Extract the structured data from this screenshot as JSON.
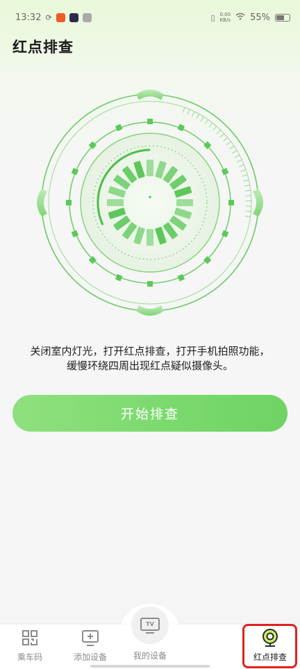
{
  "status_bar": {
    "time": "13:32",
    "net_speed_top": "0.00",
    "net_speed_bottom": "KB/s",
    "battery": "55%"
  },
  "page": {
    "title": "红点排查"
  },
  "instructions": {
    "line1": "关闭室内灯光，打开红点排查，打开手机拍照功能，",
    "line2": "缓慢环绕四周出现红点疑似摄像头。"
  },
  "start_button": {
    "label": "开始排查"
  },
  "bottom_nav": {
    "items": [
      {
        "label": "乘车码",
        "icon": "qr-code-icon"
      },
      {
        "label": "添加设备",
        "icon": "add-device-icon"
      },
      {
        "label": "我的设备",
        "icon": "tv-icon"
      },
      {
        "label": "红点排查",
        "icon": "camera-icon"
      }
    ],
    "active_index": 3,
    "tv_text": "TV"
  },
  "colors": {
    "accent": "#6fd363",
    "scanner_green": "#5cc85a",
    "highlight": "#e02020"
  }
}
